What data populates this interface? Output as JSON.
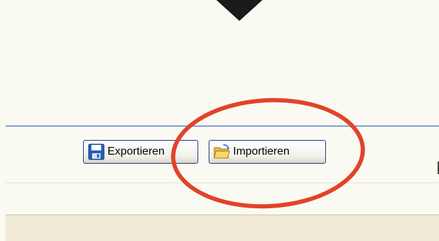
{
  "toolbar": {
    "export_label": "Exportieren",
    "import_label": "Importieren"
  },
  "icons": {
    "export": "save-floppy-icon",
    "import": "open-folder-icon"
  },
  "colors": {
    "background": "#fafaf2",
    "annotation_circle": "#e2432a",
    "pointer_arrow": "#1a1a1a",
    "divider": "#7f9fd0",
    "button_border": "#1f3a84"
  }
}
